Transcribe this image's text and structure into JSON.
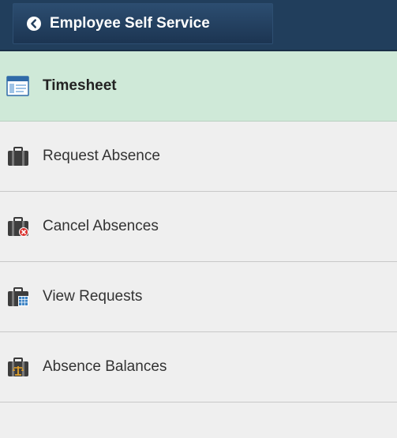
{
  "header": {
    "back_label": "Employee Self Service",
    "back_icon": "chevron-left-circle-icon"
  },
  "menu": {
    "items": [
      {
        "label": "Timesheet",
        "icon": "timesheet-window-icon",
        "active": true
      },
      {
        "label": "Request Absence",
        "icon": "briefcase-icon",
        "active": false
      },
      {
        "label": "Cancel Absences",
        "icon": "briefcase-cancel-icon",
        "active": false
      },
      {
        "label": "View Requests",
        "icon": "briefcase-calendar-icon",
        "active": false
      },
      {
        "label": "Absence Balances",
        "icon": "briefcase-balance-icon",
        "active": false
      }
    ]
  },
  "colors": {
    "header_bg": "#213e5c",
    "active_bg": "#cfe9d8",
    "list_bg": "#efefef",
    "divider": "#c8c8c8"
  }
}
